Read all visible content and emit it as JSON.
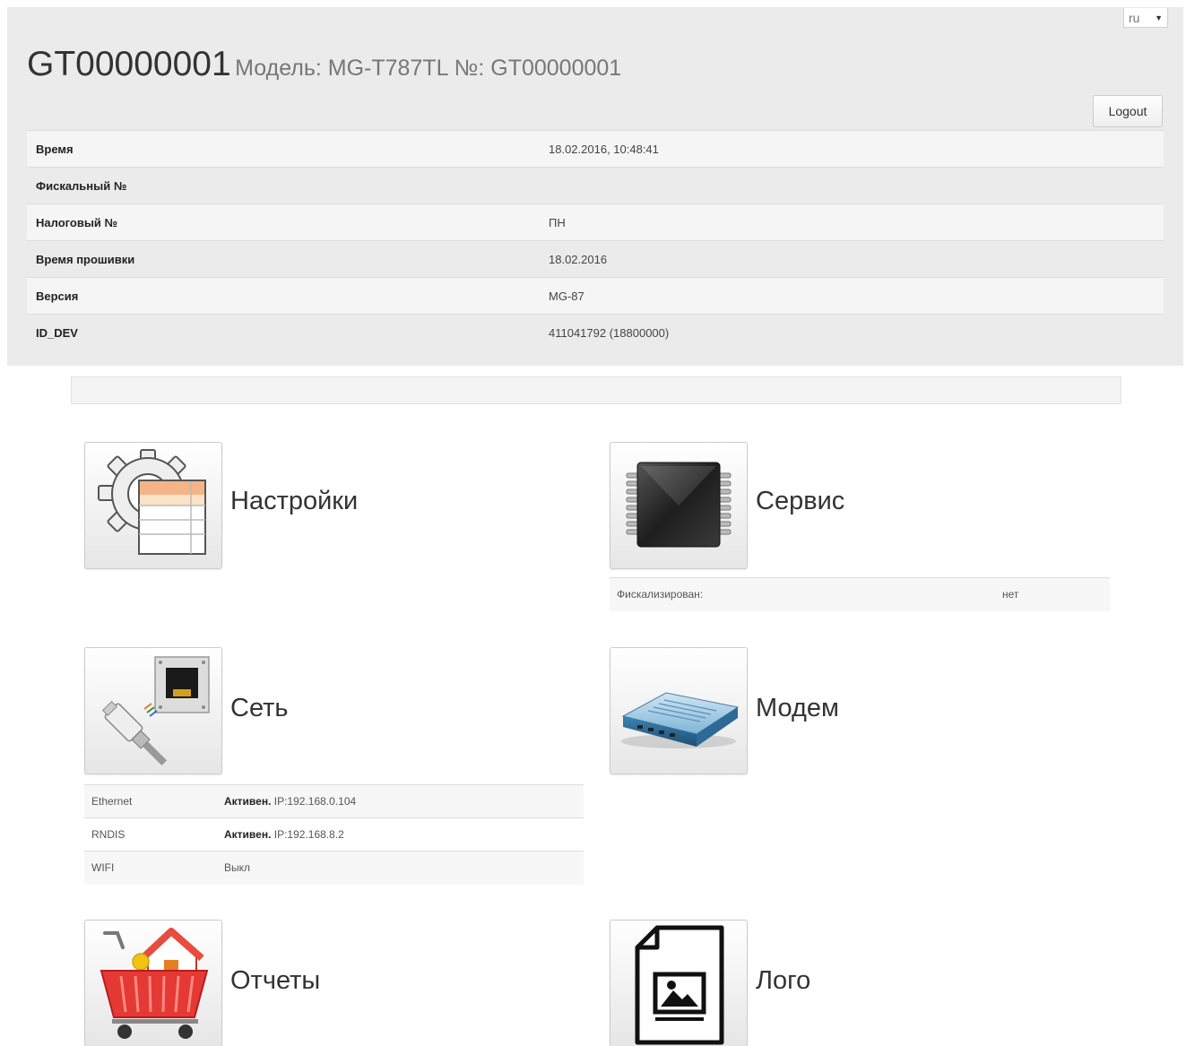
{
  "header": {
    "language": "ru",
    "device_id": "GT00000001",
    "model_text": "Модель: MG-T787TL №: GT00000001",
    "logout_label": "Logout"
  },
  "info_rows": [
    {
      "key": "Время",
      "value": "18.02.2016, 10:48:41"
    },
    {
      "key": "Фискальный №",
      "value": ""
    },
    {
      "key": "Налоговый №",
      "value": "ПН"
    },
    {
      "key": "Время прошивки",
      "value": "18.02.2016"
    },
    {
      "key": "Версия",
      "value": "MG-87"
    },
    {
      "key": "ID_DEV",
      "value": "411041792 (18800000)"
    }
  ],
  "tiles": {
    "settings": {
      "label": "Настройки",
      "icon": "gear-table-icon"
    },
    "service": {
      "label": "Сервис",
      "icon": "chip-icon",
      "rows": [
        {
          "key": "Фискализирован:",
          "value": "нет"
        }
      ]
    },
    "network": {
      "label": "Сеть",
      "icon": "ethernet-icon",
      "rows": [
        {
          "key": "Ethernet",
          "status": "Активен.",
          "detail": "IP:192.168.0.104"
        },
        {
          "key": "RNDIS",
          "status": "Активен.",
          "detail": "IP:192.168.8.2"
        },
        {
          "key": "WIFI",
          "status": "",
          "detail": "Выкл"
        }
      ]
    },
    "modem": {
      "label": "Модем",
      "icon": "modem-icon"
    },
    "reports": {
      "label": "Отчеты",
      "icon": "basket-icon"
    },
    "logo": {
      "label": "Лого",
      "icon": "image-file-icon"
    }
  },
  "colors": {
    "header_bg": "#ebebeb",
    "row_light": "#f5f5f5",
    "text": "#333333",
    "muted": "#777777"
  }
}
